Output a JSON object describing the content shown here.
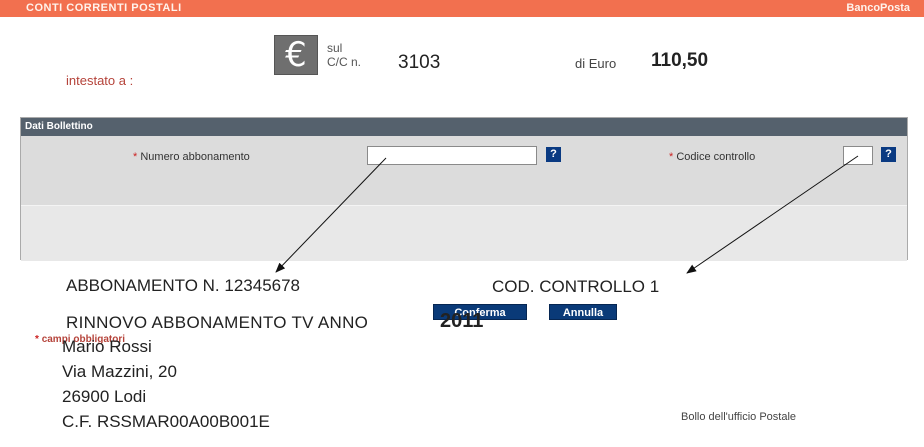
{
  "header": {
    "title": "CONTI CORRENTI POSTALI",
    "brand": "BancoPosta",
    "bar_color": "#f2704f"
  },
  "account": {
    "currency_symbol": "€",
    "sul_label": "sul",
    "cc_label": "C/C n.",
    "number": "3103",
    "di_euro_label": "di Euro",
    "amount": "110,50",
    "intestato_label": "intestato a :"
  },
  "form": {
    "section_title": "Dati Bollettino",
    "required_mark": "*",
    "numero_label": "Numero abbonamento",
    "numero_value": "",
    "codice_label": "Codice controllo",
    "codice_value": "",
    "help_icon": "?",
    "confirm_label": "Conferma",
    "cancel_label": "Annulla",
    "required_note": "campi obbligatori",
    "button_color": "#0a3a78"
  },
  "annotations": {
    "abbonamento_line": "ABBONAMENTO N. 12345678",
    "cod_line": "COD. CONTROLLO 1",
    "rinnovo": "RINNOVO ABBONAMENTO TV ANNO",
    "year": "2011",
    "name": "Mario Rossi",
    "street": "Via Mazzini, 20",
    "city": "26900 Lodi",
    "cf": "C.F. RSSMAR00A00B001E",
    "bollo": "Bollo dell'ufficio Postale"
  }
}
